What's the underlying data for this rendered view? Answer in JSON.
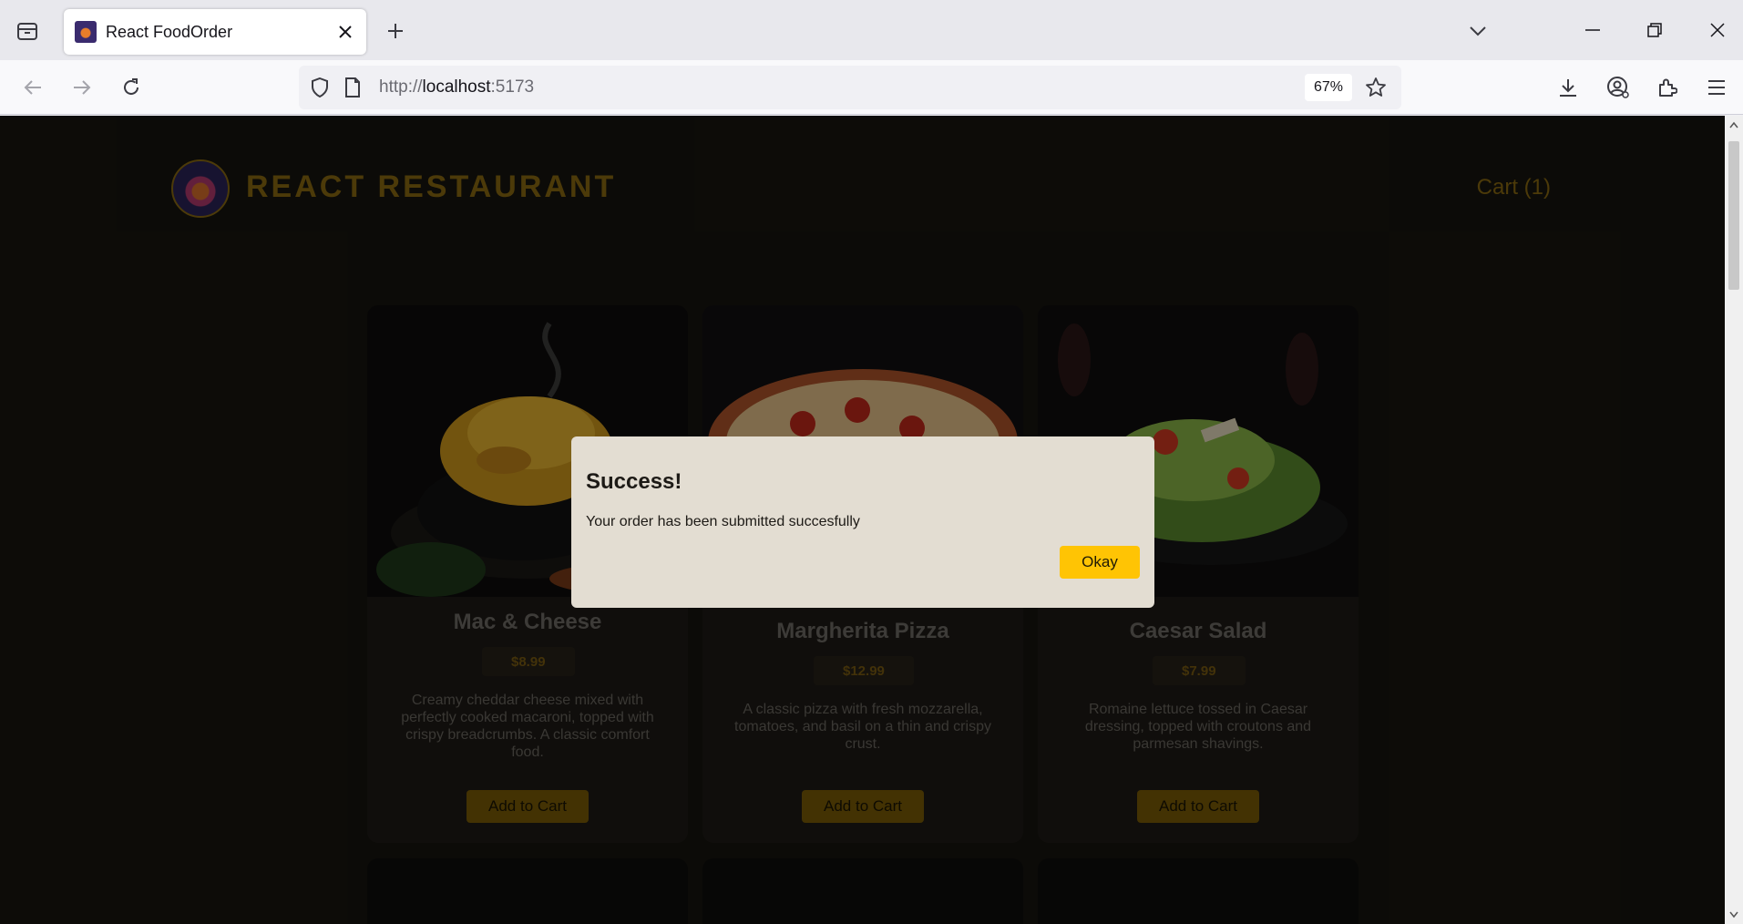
{
  "browser": {
    "tab_title": "React FoodOrder",
    "url_prefix": "http://",
    "url_host": "localhost",
    "url_port": ":5173",
    "zoom": "67%"
  },
  "site": {
    "brand": "REACT RESTAURANT",
    "cart_label": "Cart (1)"
  },
  "meals": [
    {
      "title": "Mac & Cheese",
      "price": "$8.99",
      "description": "Creamy cheddar cheese mixed with perfectly cooked macaroni, topped with crispy breadcrumbs. A classic comfort food.",
      "button": "Add to Cart"
    },
    {
      "title": "Margherita Pizza",
      "price": "$12.99",
      "description": "A classic pizza with fresh mozzarella, tomatoes, and basil on a thin and crispy crust.",
      "button": "Add to Cart"
    },
    {
      "title": "Caesar Salad",
      "price": "$7.99",
      "description": "Romaine lettuce tossed in Caesar dressing, topped with croutons and parmesan shavings.",
      "button": "Add to Cart"
    }
  ],
  "modal": {
    "title": "Success!",
    "message": "Your order has been submitted succesfully",
    "button": "Okay"
  },
  "colors": {
    "page_bg": "#17150f",
    "brand_gold": "#8a6a12",
    "modal_bg": "#e3ddd2",
    "okay_button": "#ffc404"
  }
}
